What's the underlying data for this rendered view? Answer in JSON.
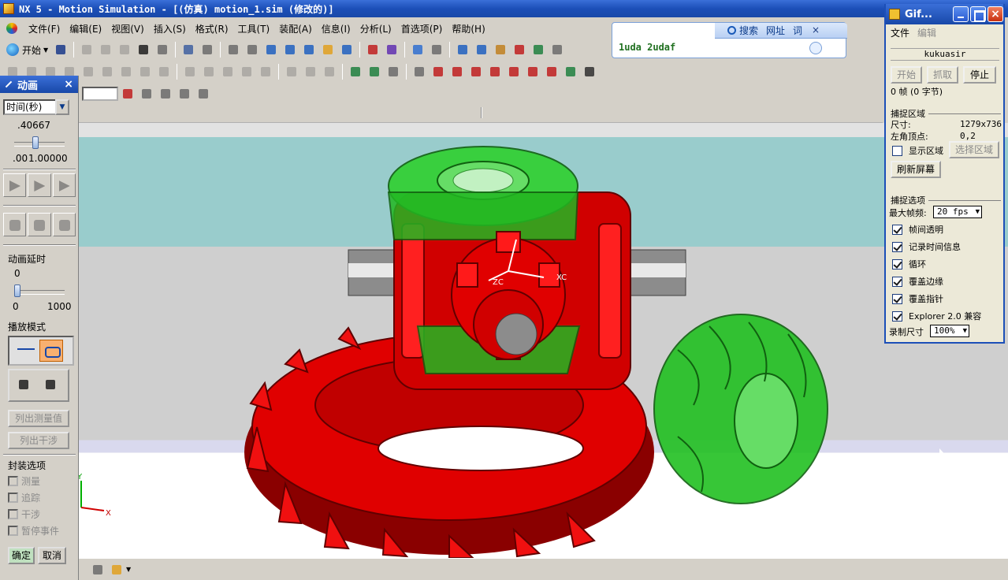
{
  "window": {
    "title": "NX 5 - Motion Simulation - [(仿真) motion_1.sim (修改的)]"
  },
  "menubar": {
    "items": [
      {
        "label": "文件(F)"
      },
      {
        "label": "编辑(E)"
      },
      {
        "label": "视图(V)"
      },
      {
        "label": "插入(S)"
      },
      {
        "label": "格式(R)"
      },
      {
        "label": "工具(T)"
      },
      {
        "label": "装配(A)"
      },
      {
        "label": "信息(I)"
      },
      {
        "label": "分析(L)"
      },
      {
        "label": "首选项(P)"
      },
      {
        "label": "帮助(H)"
      }
    ]
  },
  "toolbar": {
    "start_label": "开始"
  },
  "searchbox": {
    "tab_search": "搜索",
    "tab_url": "网址",
    "tab_dict": "词",
    "input_value": "1uda 2udaf"
  },
  "anim_panel": {
    "title": "动画",
    "time_select": "时间(秒)",
    "time_value": ".40667",
    "range_left": ".00",
    "range_right": "1.00000",
    "delay_label": "动画延时",
    "delay_value": "0",
    "delay_min": "0",
    "delay_max": "1000",
    "playmode_label": "播放模式",
    "list_measure_btn": "列出测量值",
    "list_interference_btn": "列出干涉",
    "encap_label": "封装选项",
    "checks": [
      {
        "label": "测量"
      },
      {
        "label": "追踪"
      },
      {
        "label": "干涉"
      },
      {
        "label": "暂停事件"
      }
    ],
    "ok": "确定",
    "cancel": "取消"
  },
  "viewport": {
    "axis_labels": {
      "zc": "ZC",
      "xc": "XC",
      "y": "Y",
      "x": "X"
    },
    "colors": {
      "red_gear": "#e00000",
      "green_gear": "#22b822",
      "sky": "#99cccc",
      "floor": "#cfcfcf"
    }
  },
  "gifwin": {
    "title": "Gif...",
    "menu_file": "文件",
    "menu_edit": "编辑",
    "user": "kukuasir",
    "btn_start": "开始",
    "btn_capture": "抓取",
    "btn_stop": "停止",
    "frames_info": "0 帧 (0 字节)",
    "capture_area_label": "捕捉区域",
    "size_label": "尺寸:",
    "size_value": "1279x736",
    "corner_label": "左角顶点:",
    "corner_value": "0,2",
    "show_area": "显示区域",
    "select_area": "选择区域",
    "refresh": "刷新屏幕",
    "capture_options_label": "捕捉选项",
    "max_fps_label": "最大帧频:",
    "max_fps_value": "20 fps",
    "options": [
      {
        "label": "帧间透明",
        "checked": true
      },
      {
        "label": "记录时间信息",
        "checked": true
      },
      {
        "label": "循环",
        "checked": true
      },
      {
        "label": "覆盖边缘",
        "checked": true
      },
      {
        "label": "覆盖指针",
        "checked": true
      },
      {
        "label": "Explorer 2.0 兼容",
        "checked": true
      }
    ],
    "record_size_label": "录制尺寸",
    "record_size_value": "100%"
  }
}
